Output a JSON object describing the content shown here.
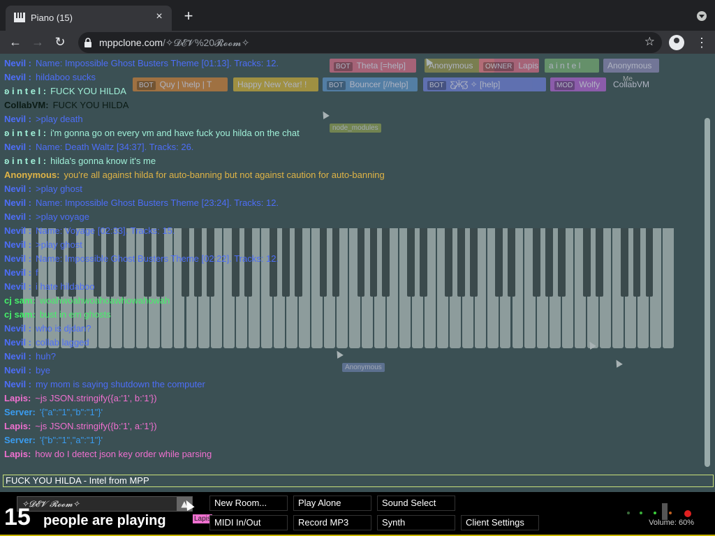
{
  "browser": {
    "tab_title": "Piano (15)",
    "new_tab_label": "+",
    "close_label": "×",
    "url_domain": "mppclone.com",
    "url_path": "/✧𝓓𝓔𝓥%20𝓡𝓸𝓸𝓶✧"
  },
  "users": [
    {
      "label": "Theta [=help]",
      "tag": "BOT",
      "color": "#c06880"
    },
    {
      "label": "Anonymous",
      "tag": "",
      "color": "#8a8a50"
    },
    {
      "label": "Lapis",
      "tag": "OWNER",
      "color": "#c06880"
    },
    {
      "label": "a i n t e l",
      "tag": "",
      "color": "#70a070"
    },
    {
      "label": "Anonymous",
      "tag": "",
      "color": "#8080a8"
    },
    {
      "label": "Quy | \\help | T",
      "tag": "BOT",
      "color": "#b87a3e"
    },
    {
      "label": "Happy New Year! !",
      "tag": "",
      "color": "#b8a03e"
    },
    {
      "label": "Bouncer [//help]",
      "tag": "BOT",
      "color": "#5a8ab8"
    },
    {
      "label": "Ƹ̵̡Ӝ̵̨̄Ʒ ✧ [help]",
      "tag": "BOT",
      "color": "#6878c8"
    },
    {
      "label": "Wolfy",
      "tag": "MOD",
      "color": "#a060c0"
    },
    {
      "label": "CollabVM",
      "tag": "",
      "color": "transparent"
    }
  ],
  "chat": [
    {
      "name": "Nevil :",
      "text": "Name: Impossible Ghost Busters Theme [01:13]. Tracks: 12.",
      "cls": "c-nevil"
    },
    {
      "name": "Nevil :",
      "text": "hildaboo sucks",
      "cls": "c-nevil"
    },
    {
      "name": "ʚ i n t e l :",
      "text": "FUCK YOU HILDA",
      "cls": "c-intel"
    },
    {
      "name": "CollabVM:",
      "text": "FUCK YOU HILDA",
      "cls": "c-collab"
    },
    {
      "name": "Nevil :",
      "text": ">play death",
      "cls": "c-nevil"
    },
    {
      "name": "ʚ i n t e l :",
      "text": "i'm gonna go on every vm and have fuck you hilda on the chat",
      "cls": "c-intel"
    },
    {
      "name": "Nevil :",
      "text": "Name: Death Waltz [34:37]. Tracks: 26.",
      "cls": "c-nevil"
    },
    {
      "name": "ʚ i n t e l :",
      "text": "hilda's gonna know it's me",
      "cls": "c-intel"
    },
    {
      "name": "Anonymous:",
      "text": "you're all against hilda for auto-banning but not against caution for auto-banning",
      "cls": "c-anon"
    },
    {
      "name": "Nevil :",
      "text": ">play ghost",
      "cls": "c-nevil"
    },
    {
      "name": "Nevil :",
      "text": "Name: Impossible Ghost Busters Theme [23:24]. Tracks: 12.",
      "cls": "c-nevil"
    },
    {
      "name": "Nevil :",
      "text": ">play voyage",
      "cls": "c-nevil"
    },
    {
      "name": "Nevil :",
      "text": "Name: Voyage [02:33]. Tracks: 15.",
      "cls": "c-nevil"
    },
    {
      "name": "Nevil :",
      "text": ">play ghost",
      "cls": "c-nevil"
    },
    {
      "name": "Nevil :",
      "text": "Name: Impossible Ghost Busters Theme [02:22]. Tracks: 12.",
      "cls": "c-nevil"
    },
    {
      "name": "Nevil :",
      "text": "f",
      "cls": "c-nevil"
    },
    {
      "name": "Nevil :",
      "text": "i hate hildaboo",
      "cls": "c-nevil"
    },
    {
      "name": "cj sam:",
      "text": "woahwoahwoahoawhowahowah",
      "cls": "c-cj"
    },
    {
      "name": "cj sam:",
      "text": "bust in em ghosts",
      "cls": "c-cj"
    },
    {
      "name": "Nevil :",
      "text": "who is djdan?",
      "cls": "c-nevil"
    },
    {
      "name": "Nevil :",
      "text": "collab lagged",
      "cls": "c-nevil"
    },
    {
      "name": "Nevil :",
      "text": "huh?",
      "cls": "c-nevil"
    },
    {
      "name": "Nevil :",
      "text": "bye",
      "cls": "c-nevil"
    },
    {
      "name": "Nevil :",
      "text": "my mom is saying shutdown the computer",
      "cls": "c-nevil"
    },
    {
      "name": "Lapis:",
      "text": "~js JSON.stringify({a:'1', b:'1'})",
      "cls": "c-lapis"
    },
    {
      "name": "Server:",
      "text": "'{\"a\":\"1\",\"b\":\"1\"}'",
      "cls": "c-server"
    },
    {
      "name": "Lapis:",
      "text": "~js JSON.stringify({b:'1', a:'1'})",
      "cls": "c-lapis"
    },
    {
      "name": "Server:",
      "text": "'{\"b\":\"1\",\"a\":\"1\"}'",
      "cls": "c-server"
    },
    {
      "name": "Lapis:",
      "text": "how do I detect json key order while parsing",
      "cls": "c-lapis"
    }
  ],
  "cursor_tags": [
    "Anonymous",
    "node_modules",
    "Me"
  ],
  "chat_input": {
    "value": "FUCK YOU HILDA - Intel from MPP"
  },
  "room": {
    "name": "✧𝓓𝓔𝓥 𝓡𝓸𝓸𝓶✧",
    "dropdown": "▲"
  },
  "people": {
    "count": "15",
    "label": "people are playing",
    "owner_badge": "Lapis"
  },
  "buttons": {
    "new_room": "New Room...",
    "play_alone": "Play Alone",
    "sound_select": "Sound Select",
    "midi": "MIDI In/Out",
    "record": "Record MP3",
    "synth": "Synth",
    "client_settings": "Client Settings"
  },
  "volume": {
    "label": "Volume: 60%",
    "value": 0.6
  }
}
